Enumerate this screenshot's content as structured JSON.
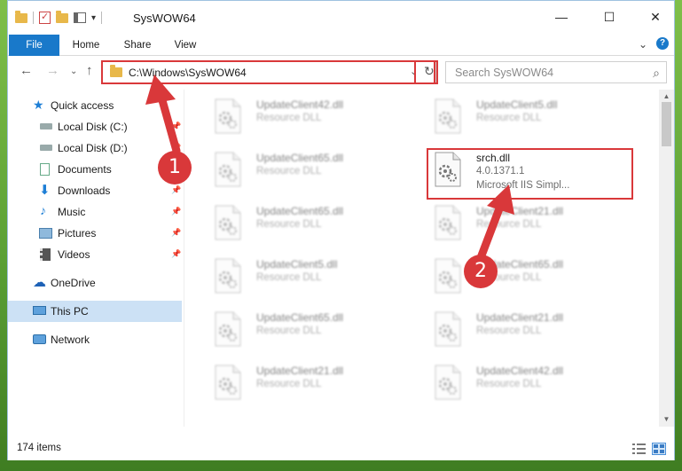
{
  "window": {
    "title": "SysWOW64",
    "controls": {
      "minimize": "—",
      "maximize": "☐",
      "close": "✕"
    }
  },
  "ribbon": {
    "tabs": [
      {
        "label": "File",
        "active": true
      },
      {
        "label": "Home"
      },
      {
        "label": "Share"
      },
      {
        "label": "View"
      }
    ],
    "collapse_glyph": "⌄",
    "help_glyph": "?"
  },
  "nav": {
    "back": "←",
    "forward": "→",
    "recent": "⌄",
    "up": "↑",
    "address_path": "C:\\Windows\\SysWOW64",
    "address_dropdown": "⌄",
    "refresh": "↻",
    "search_placeholder": "Search SysWOW64",
    "search_icon": "search-icon"
  },
  "sidebar": {
    "items": [
      {
        "label": "Quick access",
        "icon": "star-icon",
        "pinned": false
      },
      {
        "label": "Local Disk (C:)",
        "icon": "drive-icon",
        "pinned": true
      },
      {
        "label": "Local Disk (D:)",
        "icon": "drive-icon",
        "pinned": true
      },
      {
        "label": "Documents",
        "icon": "documents-icon",
        "pinned": true
      },
      {
        "label": "Downloads",
        "icon": "downloads-icon",
        "pinned": true
      },
      {
        "label": "Music",
        "icon": "music-icon",
        "pinned": true
      },
      {
        "label": "Pictures",
        "icon": "pictures-icon",
        "pinned": true
      },
      {
        "label": "Videos",
        "icon": "videos-icon",
        "pinned": true
      },
      {
        "label": "OneDrive",
        "icon": "onedrive-icon",
        "pinned": false
      },
      {
        "label": "This PC",
        "icon": "pc-icon",
        "pinned": false,
        "selected": true
      },
      {
        "label": "Network",
        "icon": "network-icon",
        "pinned": false
      }
    ]
  },
  "files": [
    {
      "name": "UpdateClient42.dll",
      "desc": "Resource DLL",
      "blurred": true
    },
    {
      "name": "UpdateClient5.dll",
      "desc": "Resource DLL",
      "blurred": true
    },
    {
      "name": "UpdateClient65.dll",
      "desc": "Resource DLL",
      "blurred": true
    },
    {
      "name": "srch.dll",
      "desc": "4.0.1371.1",
      "desc2": "Microsoft IIS Simpl...",
      "blurred": false
    },
    {
      "name": "UpdateClient65.dll",
      "desc": "Resource DLL",
      "blurred": true
    },
    {
      "name": "UpdateClient21.dll",
      "desc": "Resource DLL",
      "blurred": true
    },
    {
      "name": "UpdateClient5.dll",
      "desc": "Resource DLL",
      "blurred": true
    },
    {
      "name": "UpdateClient65.dll",
      "desc": "Resource DLL",
      "blurred": true
    },
    {
      "name": "UpdateClient65.dll",
      "desc": "Resource DLL",
      "blurred": true
    },
    {
      "name": "UpdateClient21.dll",
      "desc": "Resource DLL",
      "blurred": true
    },
    {
      "name": "UpdateClient21.dll",
      "desc": "Resource DLL",
      "blurred": true
    },
    {
      "name": "UpdateClient42.dll",
      "desc": "Resource DLL",
      "blurred": true
    }
  ],
  "status": {
    "item_count": "174 items"
  },
  "annotations": {
    "step1": "1",
    "step2": "2",
    "color": "#d9383a"
  }
}
